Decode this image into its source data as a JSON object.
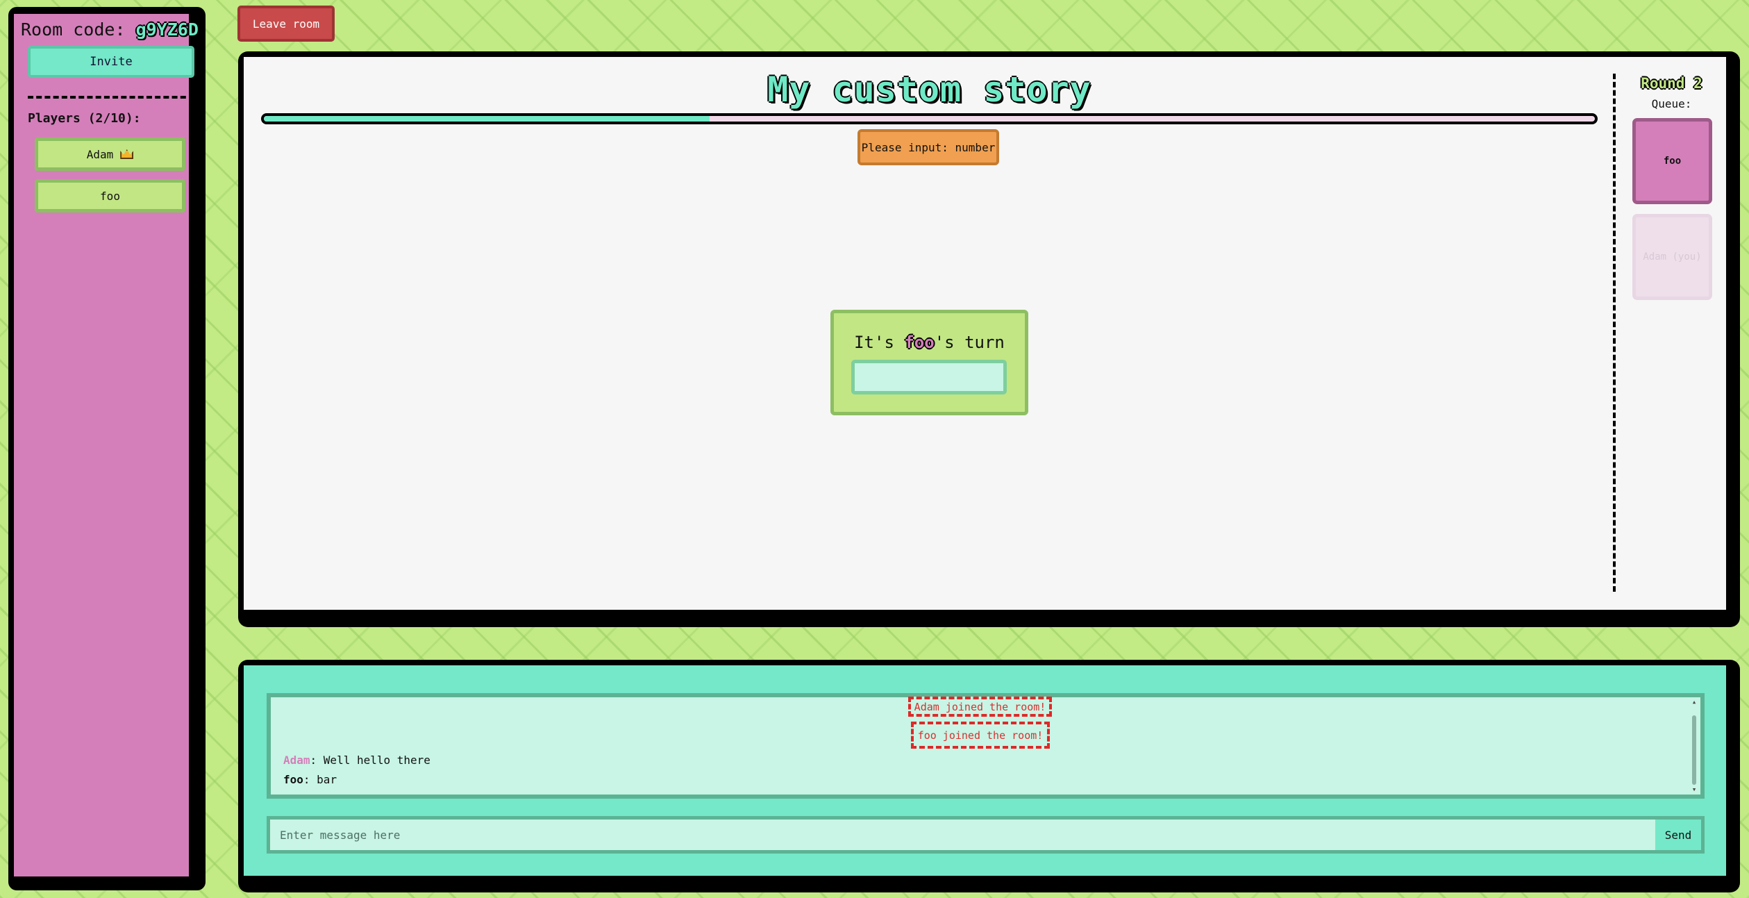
{
  "sidebar": {
    "room_code_label": "Room code:",
    "room_code": "g9YZ6D",
    "invite_label": "Invite",
    "players_heading": "Players (2/10):",
    "players": [
      {
        "name": "Adam",
        "host": true
      },
      {
        "name": "foo",
        "host": false
      }
    ]
  },
  "leave_label": "Leave room",
  "game": {
    "title": "My custom story",
    "progress": 0.335,
    "prompt": "Please input: number",
    "turn_prefix": "It's ",
    "turn_player": "foo",
    "turn_suffix": "'s turn",
    "input_value": ""
  },
  "queue": {
    "round": "Round 2",
    "label": "Queue:",
    "entries": [
      "foo",
      "Adam (you)"
    ]
  },
  "chat": {
    "system_messages": [
      "Adam joined the room!",
      "foo joined the room!"
    ],
    "messages": [
      {
        "author": "Adam",
        "sep": ": ",
        "text": "Well hello there"
      },
      {
        "author": "foo",
        "sep": ": ",
        "text": "bar"
      }
    ],
    "placeholder": "Enter message here",
    "input_value": "",
    "send_label": "Send"
  },
  "colors": {
    "accent": "#6fe9c6",
    "pink": "#d47fba",
    "green": "#c2e684",
    "danger": "#c94a4a",
    "warning": "#f0a050"
  }
}
